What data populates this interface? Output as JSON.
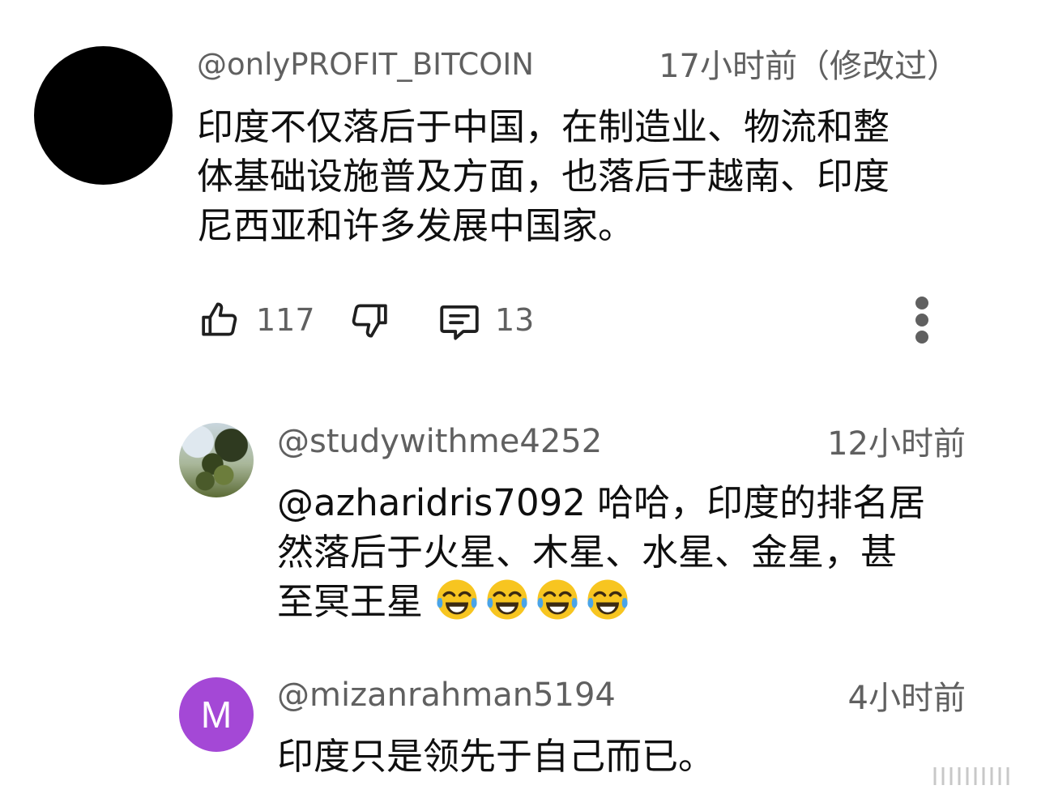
{
  "comments": [
    {
      "username": "@onlyPROFIT_BITCOIN",
      "timestamp": "17小时前（修改过）",
      "lines": [
        "印度不仅落后于中国，在制造业、物流和整",
        "体基础设施普及方面，也落后于越南、印度",
        "尼西亚和许多发展中国家。"
      ],
      "likes": "117",
      "replies": "13",
      "avatar_color": "#000000"
    }
  ],
  "replies": [
    {
      "username": "@studywithme4252",
      "timestamp": "12小时前",
      "lines": [
        "@azharidris7092 哈哈，印度的排名居",
        "然落后于火星、木星、水星、金星，甚",
        "至冥王星"
      ],
      "emoji": "face-with-tears-of-joy",
      "emoji_count": 4
    },
    {
      "username": "@mizanrahman5194",
      "timestamp": "4小时前",
      "avatar_letter": "M",
      "avatar_color": "#a448d6",
      "lines": [
        "印度只是领先于自己而已。"
      ]
    }
  ]
}
